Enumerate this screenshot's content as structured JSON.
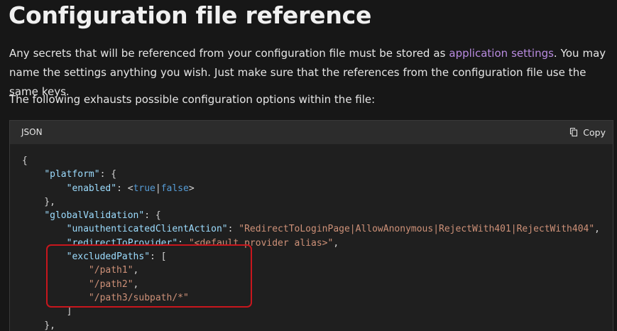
{
  "page": {
    "title": "Configuration file reference",
    "intro_before_link": "Any secrets that will be referenced from your configuration file must be stored as ",
    "intro_link": "application settings",
    "intro_after_link": ". You may name the settings anything you wish. Just make sure that the references from the configuration file use the same keys.",
    "intro2": "The following exhausts possible configuration options within the file:"
  },
  "code_block": {
    "language": "JSON",
    "copy_label": "Copy",
    "copy_icon": "copy-icon",
    "lines": [
      [
        {
          "t": "p",
          "v": "{"
        }
      ],
      [
        {
          "t": "p",
          "v": "    "
        },
        {
          "t": "key",
          "v": "\"platform\""
        },
        {
          "t": "p",
          "v": ": {"
        }
      ],
      [
        {
          "t": "p",
          "v": "        "
        },
        {
          "t": "key",
          "v": "\"enabled\""
        },
        {
          "t": "p",
          "v": ": <"
        },
        {
          "t": "kw",
          "v": "true"
        },
        {
          "t": "p",
          "v": "|"
        },
        {
          "t": "kw",
          "v": "false"
        },
        {
          "t": "p",
          "v": ">"
        }
      ],
      [
        {
          "t": "p",
          "v": "    },"
        }
      ],
      [
        {
          "t": "p",
          "v": "    "
        },
        {
          "t": "key",
          "v": "\"globalValidation\""
        },
        {
          "t": "p",
          "v": ": {"
        }
      ],
      [
        {
          "t": "p",
          "v": "        "
        },
        {
          "t": "key",
          "v": "\"unauthenticatedClientAction\""
        },
        {
          "t": "p",
          "v": ": "
        },
        {
          "t": "str",
          "v": "\"RedirectToLoginPage|AllowAnonymous|RejectWith401|RejectWith404\""
        },
        {
          "t": "p",
          "v": ","
        }
      ],
      [
        {
          "t": "p",
          "v": "        "
        },
        {
          "t": "key",
          "v": "\"redirectToProvider\""
        },
        {
          "t": "p",
          "v": ": "
        },
        {
          "t": "str",
          "v": "\"<default provider alias>\""
        },
        {
          "t": "p",
          "v": ","
        }
      ],
      [
        {
          "t": "p",
          "v": "        "
        },
        {
          "t": "key",
          "v": "\"excludedPaths\""
        },
        {
          "t": "p",
          "v": ": ["
        }
      ],
      [
        {
          "t": "p",
          "v": "            "
        },
        {
          "t": "str",
          "v": "\"/path1\""
        },
        {
          "t": "p",
          "v": ","
        }
      ],
      [
        {
          "t": "p",
          "v": "            "
        },
        {
          "t": "str",
          "v": "\"/path2\""
        },
        {
          "t": "p",
          "v": ","
        }
      ],
      [
        {
          "t": "p",
          "v": "            "
        },
        {
          "t": "str",
          "v": "\"/path3/subpath/*\""
        }
      ],
      [
        {
          "t": "p",
          "v": "        ]"
        }
      ],
      [
        {
          "t": "p",
          "v": "    },"
        }
      ]
    ]
  },
  "colors": {
    "background": "#171717",
    "link": "#b98be0",
    "json_key": "#9cdcfe",
    "json_string": "#ce9178",
    "json_keyword": "#569cd6",
    "highlight_border": "#c8161d"
  }
}
